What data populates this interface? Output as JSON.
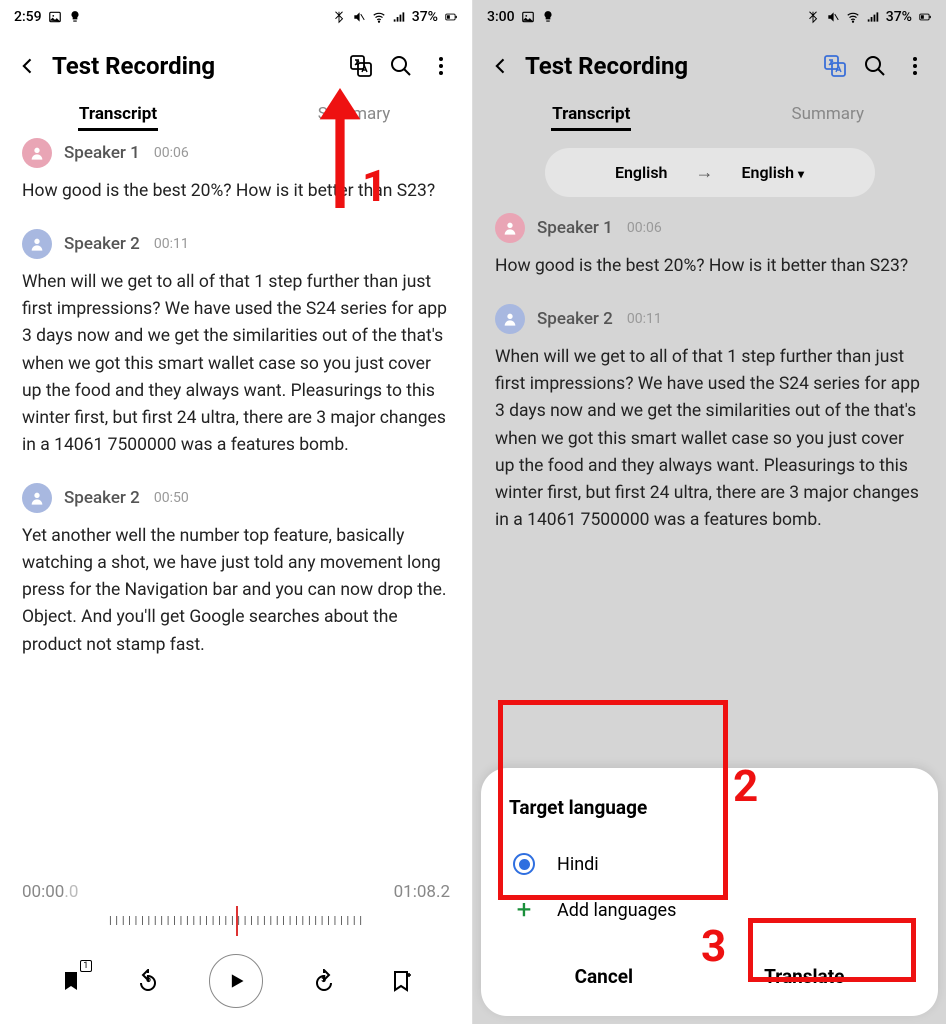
{
  "left": {
    "status": {
      "time": "2:59",
      "battery": "37%"
    },
    "title": "Test Recording",
    "tabs": {
      "transcript": "Transcript",
      "summary": "Summary"
    },
    "entries": [
      {
        "speaker": "Speaker 1",
        "ts": "00:06",
        "text": "How good is the best 20%? How is it better than S23?",
        "cls": "s1"
      },
      {
        "speaker": "Speaker 2",
        "ts": "00:11",
        "text": "When will we get to all of that 1 step further than just first impressions? We have used the S24 series for app 3 days now and we get the similarities out of the that's when we got this smart wallet case so you just cover up the food and they always want. Pleasurings to this winter first, but first 24 ultra, there are 3 major changes in a 14061 7500000 was a features bomb.",
        "cls": "s2"
      },
      {
        "speaker": "Speaker 2",
        "ts": "00:50",
        "text": "Yet another well the number top feature, basically watching a shot, we have just told any movement long press for the Navigation bar and you can now drop the. Object. And you'll get Google searches about the product not stamp fast.",
        "cls": "s2"
      }
    ],
    "player": {
      "cur": "00:00",
      "frac": ".0",
      "total": "01:08.2",
      "skip": "5",
      "bookmark_count": "1"
    }
  },
  "right": {
    "status": {
      "time": "3:00",
      "battery": "37%"
    },
    "title": "Test Recording",
    "tabs": {
      "transcript": "Transcript",
      "summary": "Summary"
    },
    "lang": {
      "from": "English",
      "to": "English"
    },
    "entries": [
      {
        "speaker": "Speaker 1",
        "ts": "00:06",
        "text": "How good is the best 20%? How is it better than S23?",
        "cls": "s1"
      },
      {
        "speaker": "Speaker 2",
        "ts": "00:11",
        "text": "When will we get to all of that 1 step further than just first impressions? We have used the S24 series for app 3 days now and we get the similarities out of the that's when we got this smart wallet case so you just cover up the food and they always want. Pleasurings to this winter first, but first 24 ultra, there are 3 major changes in a 14061 7500000 was a features bomb.",
        "cls": "s2"
      }
    ],
    "sheet": {
      "title": "Target language",
      "option": "Hindi",
      "add": "Add languages",
      "cancel": "Cancel",
      "translate": "Translate"
    }
  },
  "annotations": {
    "n1": "1",
    "n2": "2",
    "n3": "3"
  }
}
